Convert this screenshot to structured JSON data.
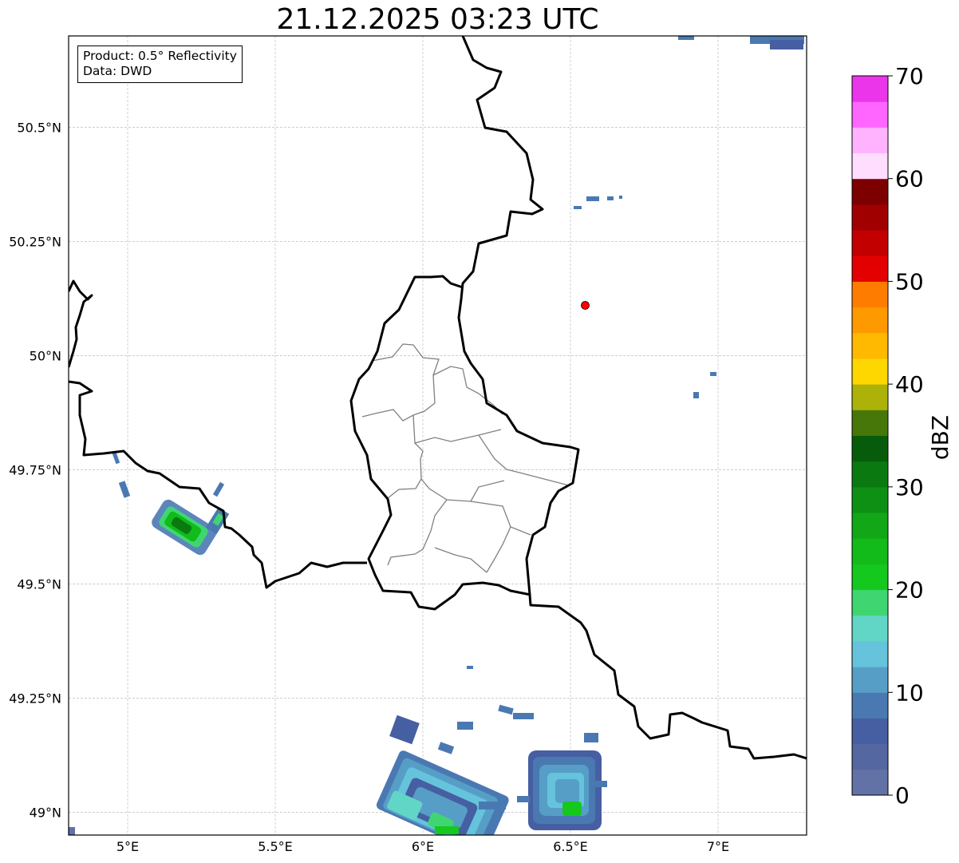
{
  "title": "21.12.2025 03:23 UTC",
  "info": {
    "product": "Product: 0.5° Reflectivity",
    "data": "Data: DWD"
  },
  "axes": {
    "lon_ticks": [
      {
        "value": 5.0,
        "label": "5°E"
      },
      {
        "value": 5.5,
        "label": "5.5°E"
      },
      {
        "value": 6.0,
        "label": "6°E"
      },
      {
        "value": 6.5,
        "label": "6.5°E"
      },
      {
        "value": 7.0,
        "label": "7°E"
      }
    ],
    "lat_ticks": [
      {
        "value": 50.5,
        "label": "50.5°N"
      },
      {
        "value": 50.25,
        "label": "50.25°N"
      },
      {
        "value": 50.0,
        "label": "50°N"
      },
      {
        "value": 49.75,
        "label": "49.75°N"
      },
      {
        "value": 49.5,
        "label": "49.5°N"
      },
      {
        "value": 49.25,
        "label": "49.25°N"
      },
      {
        "value": 49.0,
        "label": "49°N"
      }
    ],
    "lon_range": [
      4.8,
      7.3
    ],
    "lat_range": [
      48.95,
      50.7
    ],
    "grid": true
  },
  "marker": {
    "lon": 6.55,
    "lat": 50.11,
    "color": "#ff0000"
  },
  "colorbar": {
    "label": "dBZ",
    "min": 0,
    "max": 70,
    "ticks": [
      {
        "value": 0,
        "label": "0"
      },
      {
        "value": 10,
        "label": "10"
      },
      {
        "value": 20,
        "label": "20"
      },
      {
        "value": 30,
        "label": "30"
      },
      {
        "value": 40,
        "label": "40"
      },
      {
        "value": 50,
        "label": "50"
      },
      {
        "value": 60,
        "label": "60"
      },
      {
        "value": 70,
        "label": "70"
      }
    ],
    "colors": [
      "#6271a6",
      "#5567a0",
      "#465fa2",
      "#4a79b2",
      "#579ec7",
      "#65c3dc",
      "#62d6c6",
      "#3fd672",
      "#14c81e",
      "#12ba1a",
      "#11a717",
      "#0e9014",
      "#0a7a10",
      "#075c0b",
      "#477708",
      "#adb208",
      "#fed700",
      "#feb900",
      "#fe9a00",
      "#fe7d00",
      "#e30000",
      "#c20000",
      "#a10000",
      "#7d0000",
      "#ffddff",
      "#ffb3ff",
      "#ff66ff",
      "#eb35eb"
    ]
  },
  "radar_echoes": [
    {
      "lon": 5.2,
      "lat": 49.63,
      "max_dbz": 30
    },
    {
      "lon": 6.05,
      "lat": 49.05,
      "max_dbz": 25
    },
    {
      "lon": 6.5,
      "lat": 49.05,
      "max_dbz": 22
    },
    {
      "lon": 6.65,
      "lat": 50.33,
      "max_dbz": 5
    },
    {
      "lon": 7.1,
      "lat": 50.68,
      "max_dbz": 7
    }
  ]
}
